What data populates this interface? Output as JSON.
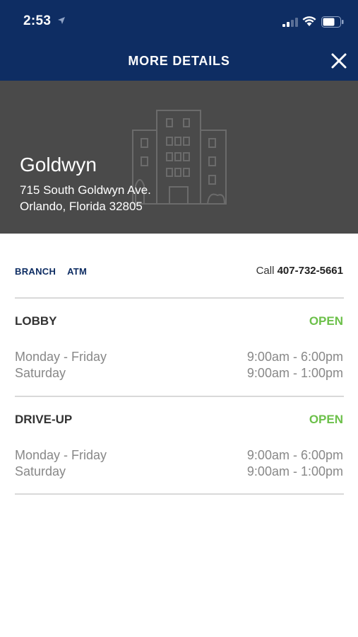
{
  "status_bar": {
    "time": "2:53",
    "icons": [
      "location-arrow-icon",
      "signal-icon",
      "wifi-icon",
      "battery-icon"
    ]
  },
  "header": {
    "title": "MORE DETAILS",
    "close_icon": "close-icon",
    "background": "#0e2d63"
  },
  "hero": {
    "name": "Goldwyn",
    "address_line1": "715 South Goldwyn Ave.",
    "address_line2": "Orlando, Florida 32805",
    "icon": "building-icon",
    "background": "#4a4a4a"
  },
  "tabs": [
    "BRANCH",
    "ATM"
  ],
  "call": {
    "label": "Call",
    "number": "407-732-5661"
  },
  "sections": [
    {
      "title": "LOBBY",
      "status": "OPEN",
      "rows": [
        {
          "day": "Monday - Friday",
          "hours": "9:00am - 6:00pm"
        },
        {
          "day": "Saturday",
          "hours": "9:00am - 1:00pm"
        }
      ]
    },
    {
      "title": "DRIVE-UP",
      "status": "OPEN",
      "rows": [
        {
          "day": "Monday - Friday",
          "hours": "9:00am - 6:00pm"
        },
        {
          "day": "Saturday",
          "hours": "9:00am - 1:00pm"
        }
      ]
    }
  ],
  "colors": {
    "accent": "#0e2d63",
    "open": "#6cc04a"
  }
}
